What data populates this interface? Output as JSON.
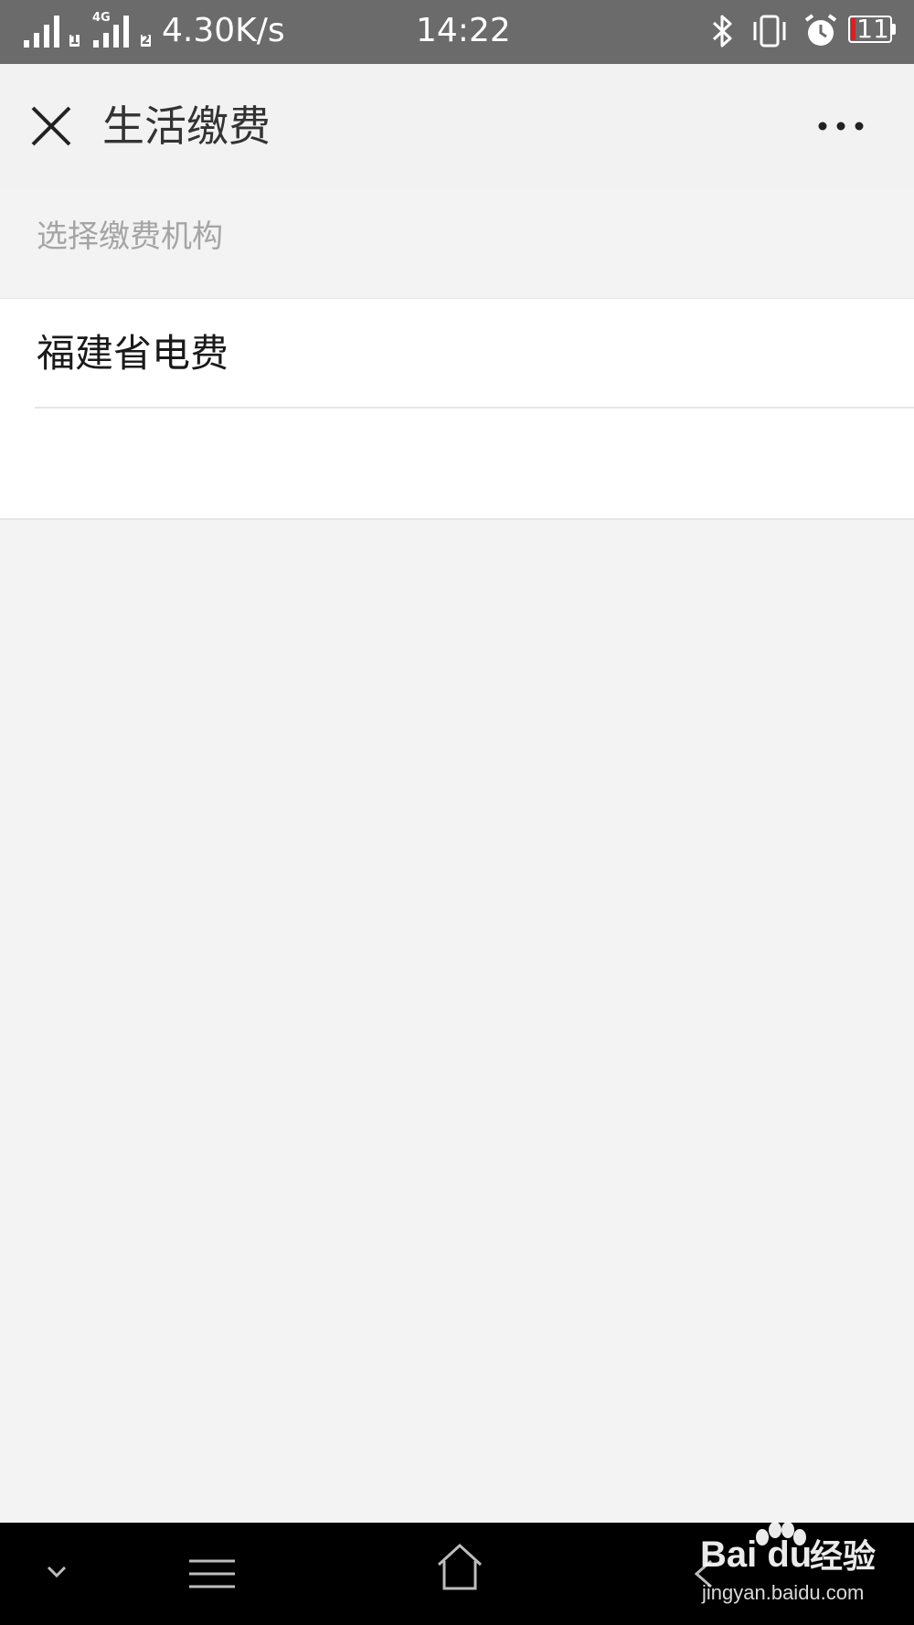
{
  "status_bar": {
    "sim1_label": "1",
    "sim2_label": "2",
    "network_type": "4G",
    "net_speed": "4.30K/s",
    "time": "14:22",
    "battery_level": "11",
    "battery_color": "#e8181c",
    "icons": [
      "signal-icon",
      "signal-icon",
      "bluetooth-icon",
      "vibrate-icon",
      "alarm-icon",
      "battery-icon"
    ]
  },
  "header": {
    "title": "生活缴费",
    "close_icon": "close-icon",
    "more_icon": "more-icon"
  },
  "section": {
    "label": "选择缴费机构"
  },
  "list": {
    "items": [
      {
        "label": "福建省电费"
      }
    ]
  },
  "nav": {
    "icons": [
      "chevron-down-icon",
      "menu-icon",
      "home-icon",
      "back-icon"
    ]
  },
  "watermark": {
    "logo_text": "Bai du",
    "brand_cn": "经验",
    "url": "jingyan.baidu.com"
  }
}
